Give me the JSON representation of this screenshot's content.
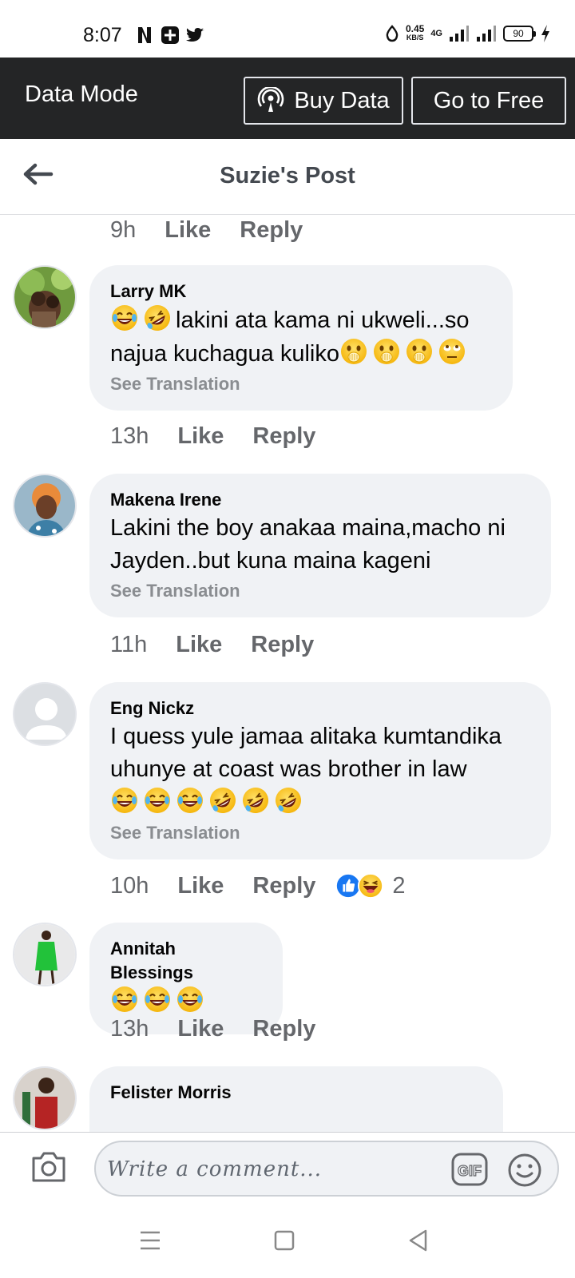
{
  "status_bar": {
    "time": "8:07",
    "speed_value": "0.45",
    "speed_unit": "KB/S",
    "network": "4G",
    "battery": "90"
  },
  "banner": {
    "title": "Data Mode",
    "buy_label": "Buy Data",
    "free_label": "Go to Free"
  },
  "header": {
    "title": "Suzie's Post"
  },
  "actions": {
    "like": "Like",
    "reply": "Reply"
  },
  "top_meta": {
    "time": "9h"
  },
  "comments": [
    {
      "name": "Larry MK",
      "text_line1": "lakini ata kama ni ukweli...so",
      "text_line2": "najua kuchagua kuliko",
      "translation": "See Translation",
      "time": "13h"
    },
    {
      "name": "Makena Irene",
      "text_line1": "Lakini the boy anakaa maina,macho ni",
      "text_line2": "Jayden..but kuna maina kageni",
      "translation": "See Translation",
      "time": "11h"
    },
    {
      "name": "Eng Nickz",
      "text_line1": "I quess yule jamaa alitaka kumtandika",
      "text_line2": "uhunye at coast was brother in law",
      "translation": "See Translation",
      "time": "10h",
      "reaction_count": "2"
    },
    {
      "name": "Annitah Blessings",
      "time": "13h"
    },
    {
      "name": "Felister Morris"
    }
  ],
  "composer": {
    "placeholder": "Write a comment..."
  },
  "icons": {
    "status": [
      "netflix-icon",
      "app-notification-icon",
      "twitter-icon",
      "data-saver-icon",
      "signal-icon",
      "battery-icon",
      "charging-icon"
    ],
    "emoji": [
      "joy-emoji",
      "rofl-emoji",
      "hand-over-mouth-emoji",
      "eye-roll-emoji",
      "like-reaction",
      "haha-reaction",
      "smiley-icon"
    ]
  },
  "colors": {
    "banner_bg": "#242526",
    "bubble_bg": "#f0f2f5",
    "secondary_text": "#65676b",
    "like_blue": "#1877f2"
  }
}
